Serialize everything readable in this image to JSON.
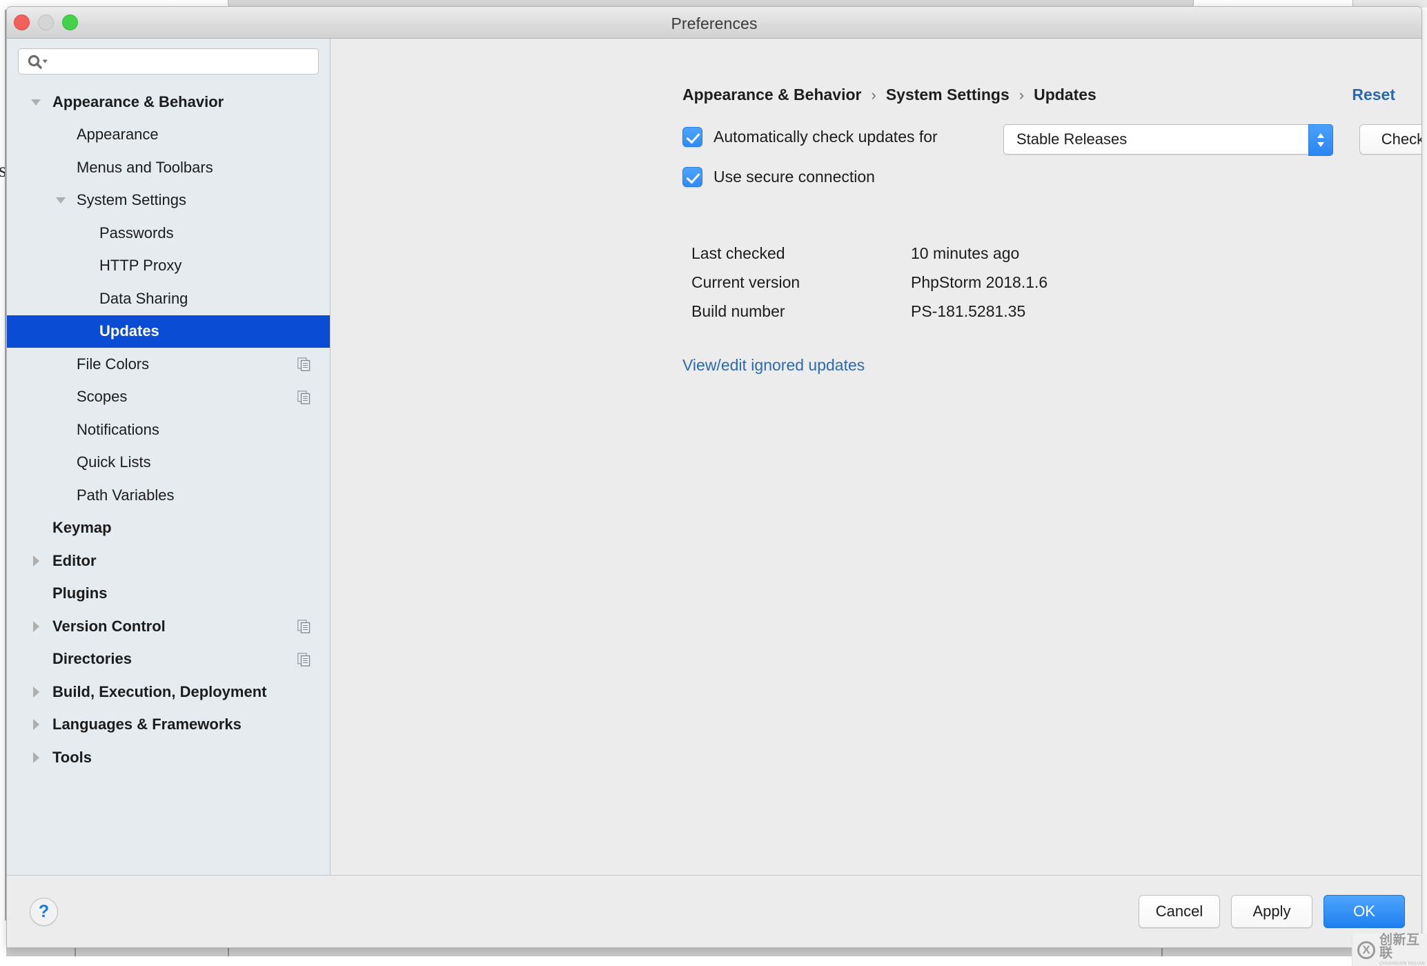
{
  "window": {
    "title": "Preferences",
    "traffic_lights": [
      "close-button",
      "minimize-button",
      "zoom-button"
    ]
  },
  "sidebar": {
    "search": {
      "value": "",
      "placeholder": ""
    },
    "items": [
      {
        "label": "Appearance & Behavior",
        "level": 0,
        "bold": true,
        "twisty": "down",
        "selected": false,
        "icon": null
      },
      {
        "label": "Appearance",
        "level": 1,
        "bold": false,
        "twisty": null,
        "selected": false,
        "icon": null
      },
      {
        "label": "Menus and Toolbars",
        "level": 1,
        "bold": false,
        "twisty": null,
        "selected": false,
        "icon": null
      },
      {
        "label": "System Settings",
        "level": 1,
        "bold": false,
        "twisty": "down",
        "selected": false,
        "icon": null
      },
      {
        "label": "Passwords",
        "level": 2,
        "bold": false,
        "twisty": null,
        "selected": false,
        "icon": null
      },
      {
        "label": "HTTP Proxy",
        "level": 2,
        "bold": false,
        "twisty": null,
        "selected": false,
        "icon": null
      },
      {
        "label": "Data Sharing",
        "level": 2,
        "bold": false,
        "twisty": null,
        "selected": false,
        "icon": null
      },
      {
        "label": "Updates",
        "level": 2,
        "bold": false,
        "twisty": null,
        "selected": true,
        "icon": null
      },
      {
        "label": "File Colors",
        "level": 1,
        "bold": false,
        "twisty": null,
        "selected": false,
        "icon": "copy-sheet-icon"
      },
      {
        "label": "Scopes",
        "level": 1,
        "bold": false,
        "twisty": null,
        "selected": false,
        "icon": "copy-sheet-icon"
      },
      {
        "label": "Notifications",
        "level": 1,
        "bold": false,
        "twisty": null,
        "selected": false,
        "icon": null
      },
      {
        "label": "Quick Lists",
        "level": 1,
        "bold": false,
        "twisty": null,
        "selected": false,
        "icon": null
      },
      {
        "label": "Path Variables",
        "level": 1,
        "bold": false,
        "twisty": null,
        "selected": false,
        "icon": null
      },
      {
        "label": "Keymap",
        "level": 0,
        "bold": true,
        "twisty": null,
        "selected": false,
        "icon": null
      },
      {
        "label": "Editor",
        "level": 0,
        "bold": true,
        "twisty": "right",
        "selected": false,
        "icon": null
      },
      {
        "label": "Plugins",
        "level": 0,
        "bold": true,
        "twisty": null,
        "selected": false,
        "icon": null
      },
      {
        "label": "Version Control",
        "level": 0,
        "bold": true,
        "twisty": "right",
        "selected": false,
        "icon": "copy-sheet-icon"
      },
      {
        "label": "Directories",
        "level": 0,
        "bold": true,
        "twisty": null,
        "selected": false,
        "icon": "copy-sheet-icon"
      },
      {
        "label": "Build, Execution, Deployment",
        "level": 0,
        "bold": true,
        "twisty": "right",
        "selected": false,
        "icon": null
      },
      {
        "label": "Languages & Frameworks",
        "level": 0,
        "bold": true,
        "twisty": "right",
        "selected": false,
        "icon": null
      },
      {
        "label": "Tools",
        "level": 0,
        "bold": true,
        "twisty": "right",
        "selected": false,
        "icon": null
      }
    ]
  },
  "main": {
    "breadcrumb": [
      "Appearance & Behavior",
      "System Settings",
      "Updates"
    ],
    "breadcrumb_separator": "›",
    "reset_label": "Reset",
    "auto_check": {
      "checked": true,
      "label": "Automatically check updates for",
      "channel_value": "Stable Releases"
    },
    "secure_connection": {
      "checked": true,
      "label": "Use secure connection"
    },
    "check_now_label": "Check Now",
    "info_rows": [
      {
        "key": "Last checked",
        "value": "10 minutes ago"
      },
      {
        "key": "Current version",
        "value": "PhpStorm 2018.1.6"
      },
      {
        "key": "Build number",
        "value": "PS-181.5281.35"
      }
    ],
    "ignored_updates_link": "View/edit ignored updates"
  },
  "footer": {
    "help_label": "?",
    "cancel_label": "Cancel",
    "apply_label": "Apply",
    "ok_label": "OK"
  },
  "watermark": {
    "mark": "X",
    "cn": "创新互联",
    "en": "CHUANGXIN HULIAN"
  },
  "colors": {
    "selection_blue": "#0B4CD4",
    "link_blue": "#2A6AB0",
    "accent_blue": "#2E8CF7",
    "sidebar_bg": "#E6EBF0",
    "panel_bg": "#ECECEC"
  },
  "bg_window": {
    "fragment_glyph": "s"
  }
}
